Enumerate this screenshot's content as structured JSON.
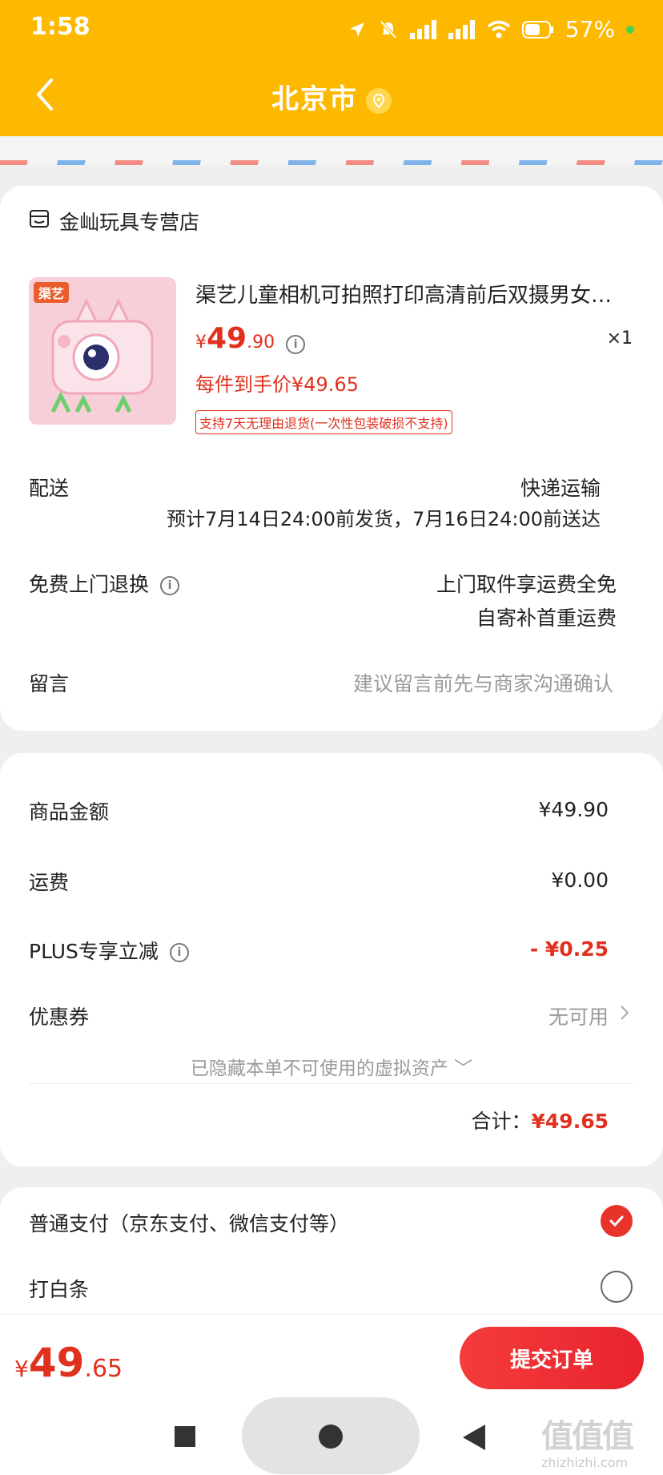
{
  "status_bar": {
    "time": "1:58",
    "battery": "57%"
  },
  "header": {
    "title": "北京市"
  },
  "store": {
    "name": "金屾玩具专营店"
  },
  "product": {
    "brand_badge": "渠艺",
    "title": "渠艺儿童相机可拍照打印高清前后双摄男女…",
    "price_symbol": "¥",
    "price_int": "49",
    "price_dec": ".90",
    "quantity": "×1",
    "net_price": "每件到手价¥49.65",
    "return_tag": "支持7天无理由退货(一次性包装破损不支持)"
  },
  "delivery": {
    "label": "配送",
    "method": "快递运输",
    "estimate": "预计7月14日24:00前发货，7月16日24:00前送达"
  },
  "free_return": {
    "label": "免费上门退换",
    "line1": "上门取件享运费全免",
    "line2": "自寄补首重运费"
  },
  "message": {
    "label": "留言",
    "placeholder": "建议留言前先与商家沟通确认"
  },
  "summary": {
    "goods_label": "商品金额",
    "goods_value": "¥49.90",
    "shipping_label": "运费",
    "shipping_value": "¥0.00",
    "plus_label": "PLUS专享立减",
    "plus_value": "- ¥0.25",
    "coupon_label": "优惠券",
    "coupon_value": "无可用",
    "hidden_assets": "已隐藏本单不可使用的虚拟资产",
    "total_label": "合计：",
    "total_value": "¥49.65"
  },
  "payment": {
    "normal": "普通支付（京东支付、微信支付等）",
    "baitiao": "打白条"
  },
  "footer": {
    "price_symbol": "¥",
    "price_int": "49",
    "price_dec": ".65",
    "submit": "提交订单"
  },
  "watermark": {
    "main": "值值值",
    "sub": "zhizhizhi.com"
  },
  "colors": {
    "accent": "#fdb900",
    "price_red": "#e0301e",
    "button_red": "#e8232f"
  }
}
